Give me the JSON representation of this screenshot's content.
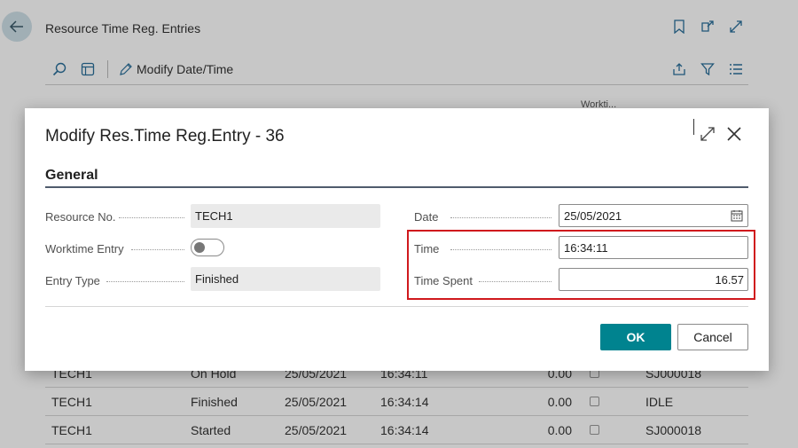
{
  "page": {
    "title": "Resource Time Reg. Entries",
    "action_modify": "Modify Date/Time",
    "column_hint": "Workti..."
  },
  "background_rows": [
    {
      "resource": "TECH1",
      "type": "On Hold",
      "date": "25/05/2021",
      "time": "16:34:11",
      "value": "0.00",
      "job": "SJ000018"
    },
    {
      "resource": "TECH1",
      "type": "Finished",
      "date": "25/05/2021",
      "time": "16:34:14",
      "value": "0.00",
      "job": "IDLE"
    },
    {
      "resource": "TECH1",
      "type": "Started",
      "date": "25/05/2021",
      "time": "16:34:14",
      "value": "0.00",
      "job": "SJ000018"
    }
  ],
  "dialog": {
    "title": "Modify Res.Time Reg.Entry - 36",
    "section": "General",
    "fields": {
      "resource_no_label": "Resource No.",
      "resource_no_value": "TECH1",
      "worktime_entry_label": "Worktime Entry",
      "entry_type_label": "Entry Type",
      "entry_type_value": "Finished",
      "date_label": "Date",
      "date_value": "25/05/2021",
      "time_label": "Time",
      "time_value": "16:34:11",
      "time_spent_label": "Time Spent",
      "time_spent_value": "16.57"
    },
    "ok_label": "OK",
    "cancel_label": "Cancel"
  },
  "colors": {
    "accent": "#00838f",
    "highlight": "#d0191d",
    "section_line": "#505c6d"
  }
}
